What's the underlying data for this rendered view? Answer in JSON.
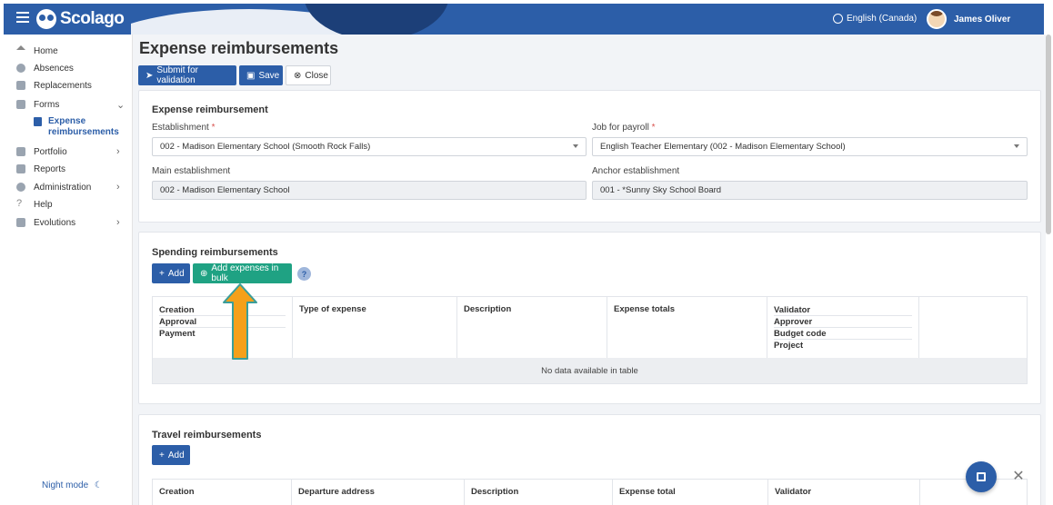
{
  "app": {
    "brand": "Scolago",
    "language": "English (Canada)",
    "user_name": "James Oliver",
    "brand_color": "#2c5ea8",
    "accent_green": "#1fa283",
    "arrow_color": "#f5a01a"
  },
  "sidebar": {
    "items": [
      {
        "label": "Home",
        "icon": "home-icon"
      },
      {
        "label": "Absences",
        "icon": "absences-icon"
      },
      {
        "label": "Replacements",
        "icon": "replacements-icon"
      },
      {
        "label": "Forms",
        "icon": "forms-icon"
      },
      {
        "label": "Portfolio",
        "icon": "trophy-icon"
      },
      {
        "label": "Reports",
        "icon": "reports-icon"
      },
      {
        "label": "Administration",
        "icon": "gear-icon"
      },
      {
        "label": "Help",
        "icon": "help-icon"
      },
      {
        "label": "Evolutions",
        "icon": "evolutions-icon"
      }
    ],
    "sub_item": "Expense reimbursements",
    "night_mode": "Night mode"
  },
  "page": {
    "title": "Expense reimbursements",
    "toolbar": {
      "submit": "Submit for validation",
      "save": "Save",
      "close": "Close"
    }
  },
  "expense_card": {
    "title": "Expense reimbursement",
    "establishment_label": "Establishment",
    "establishment_value": "002 - Madison Elementary School (Smooth Rock Falls)",
    "job_label": "Job for payroll",
    "job_value": "English Teacher Elementary (002 - Madison Elementary School)",
    "main_est_label": "Main establishment",
    "main_est_value": "002 - Madison Elementary School",
    "anchor_est_label": "Anchor establishment",
    "anchor_est_value": "001 - *Sunny Sky School Board",
    "required_mark": "*"
  },
  "spending": {
    "title": "Spending reimbursements",
    "add": "Add",
    "add_bulk": "Add expenses in bulk",
    "help": "?",
    "columns": {
      "col1": [
        "Creation",
        "Approval",
        "Payment"
      ],
      "type": "Type of expense",
      "description": "Description",
      "totals": "Expense totals",
      "col5": [
        "Validator",
        "Approver",
        "Budget code",
        "Project"
      ]
    },
    "empty": "No data available in table"
  },
  "travel": {
    "title": "Travel reimbursements",
    "add": "Add",
    "columns": [
      "Creation",
      "Departure address",
      "Description",
      "Expense total",
      "Validator"
    ]
  }
}
